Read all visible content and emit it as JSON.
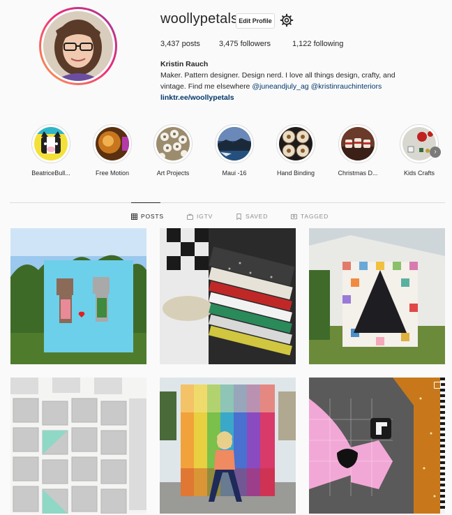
{
  "profile": {
    "username": "woollypetals",
    "edit_label": "Edit Profile",
    "posts": "3,437 posts",
    "followers": "3,475 followers",
    "following": "1,122 following",
    "full_name": "Kristin Rauch",
    "bio_line1": "Maker. Pattern designer. Design nerd. I love all things design, crafty, and",
    "bio_line2_prefix": "vintage. Find me elsewhere ",
    "mention1": "@juneandjuly_ag",
    "mention2": "@kristinrauchinteriors",
    "link": "linktr.ee/woollypetals"
  },
  "highlights": [
    {
      "label": "BeatriceBull..."
    },
    {
      "label": "Free Motion"
    },
    {
      "label": "Art Projects"
    },
    {
      "label": "Maui -16"
    },
    {
      "label": "Hand Binding"
    },
    {
      "label": "Christmas D..."
    },
    {
      "label": "Kids Crafts"
    }
  ],
  "tabs": [
    {
      "label": "POSTS",
      "icon": "grid-icon"
    },
    {
      "label": "IGTV",
      "icon": "igtv-icon"
    },
    {
      "label": "SAVED",
      "icon": "bookmark-icon"
    },
    {
      "label": "TAGGED",
      "icon": "tag-icon"
    }
  ],
  "colors": {
    "link": "#00376b",
    "border": "#dbdbdb",
    "muted": "#8e8e8e",
    "text": "#262626",
    "ring_gradient": [
      "#f9a44a",
      "#ee2a7b",
      "#833ab4"
    ]
  }
}
